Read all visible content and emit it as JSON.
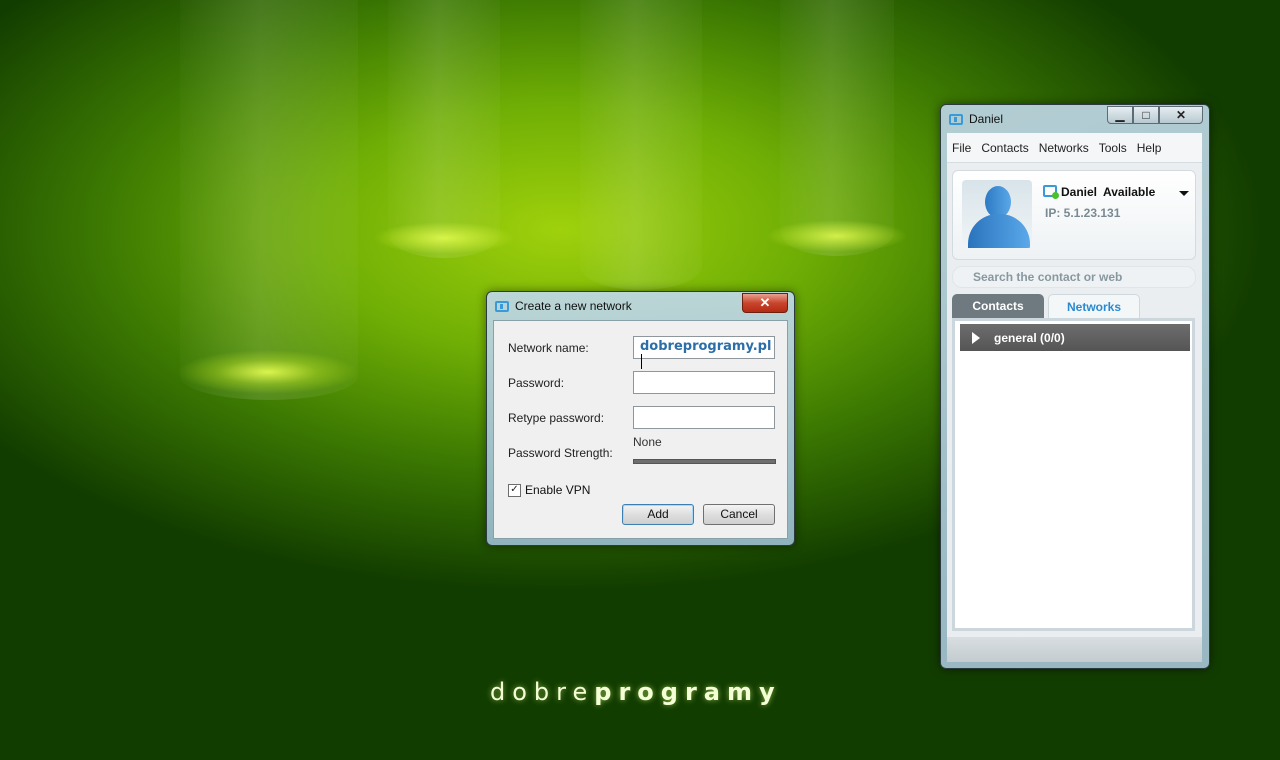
{
  "wallpaper": {
    "logo_light": "dobre",
    "logo_bold": "programy"
  },
  "dialog": {
    "title": "Create a new network",
    "close_label": "✕",
    "network_name_label": "Network name:",
    "network_name_value": "dobreprogramy.pl",
    "password_label": "Password:",
    "password_value": "",
    "retype_label": "Retype password:",
    "retype_value": "",
    "strength_label": "Password Strength:",
    "strength_value": "None",
    "strength_level": 0,
    "vpn_label": "Enable VPN",
    "vpn_checked": true,
    "add_label": "Add",
    "cancel_label": "Cancel"
  },
  "main": {
    "title": "Daniel",
    "menu": [
      "File",
      "Contacts",
      "Networks",
      "Tools",
      "Help"
    ],
    "profile": {
      "name": "Daniel",
      "status": "Available",
      "ip": "IP: 5.1.23.131"
    },
    "search_placeholder": "Search the contact or web",
    "tabs": {
      "contacts": "Contacts",
      "networks": "Networks",
      "active": "networks"
    },
    "groups": [
      {
        "label": "general (0/0)"
      }
    ]
  },
  "colors": {
    "accent_blue": "#2a8ad0",
    "group_row": "#5f5f5f",
    "close_red": "#c8452d"
  }
}
